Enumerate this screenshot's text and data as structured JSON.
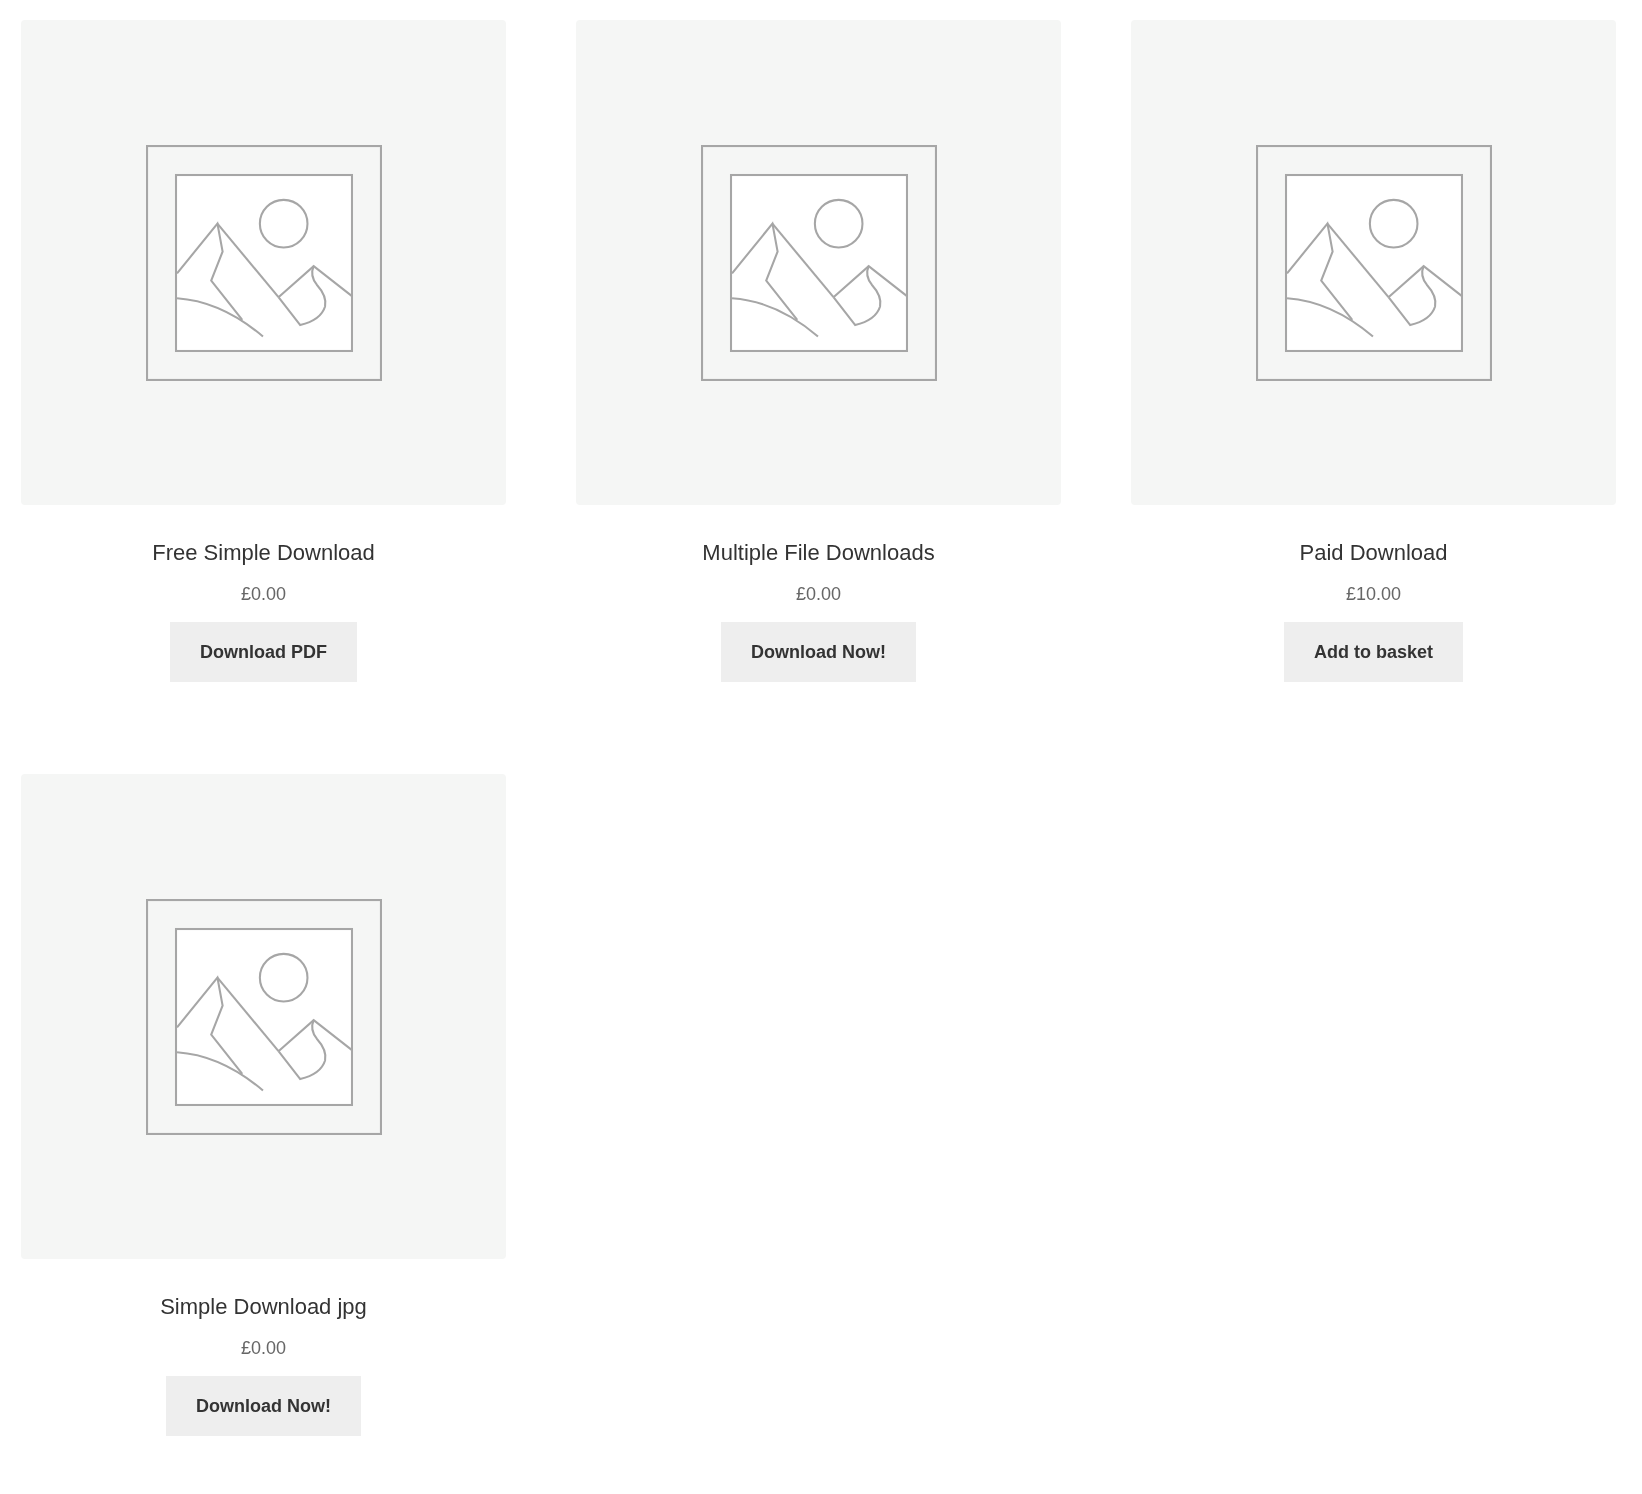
{
  "products": [
    {
      "title": "Free Simple Download",
      "price": "£0.00",
      "button": "Download PDF"
    },
    {
      "title": "Multiple File Downloads",
      "price": "£0.00",
      "button": "Download Now!"
    },
    {
      "title": "Paid Download",
      "price": "£10.00",
      "button": "Add to basket"
    },
    {
      "title": "Simple Download jpg",
      "price": "£0.00",
      "button": "Download Now!"
    }
  ]
}
